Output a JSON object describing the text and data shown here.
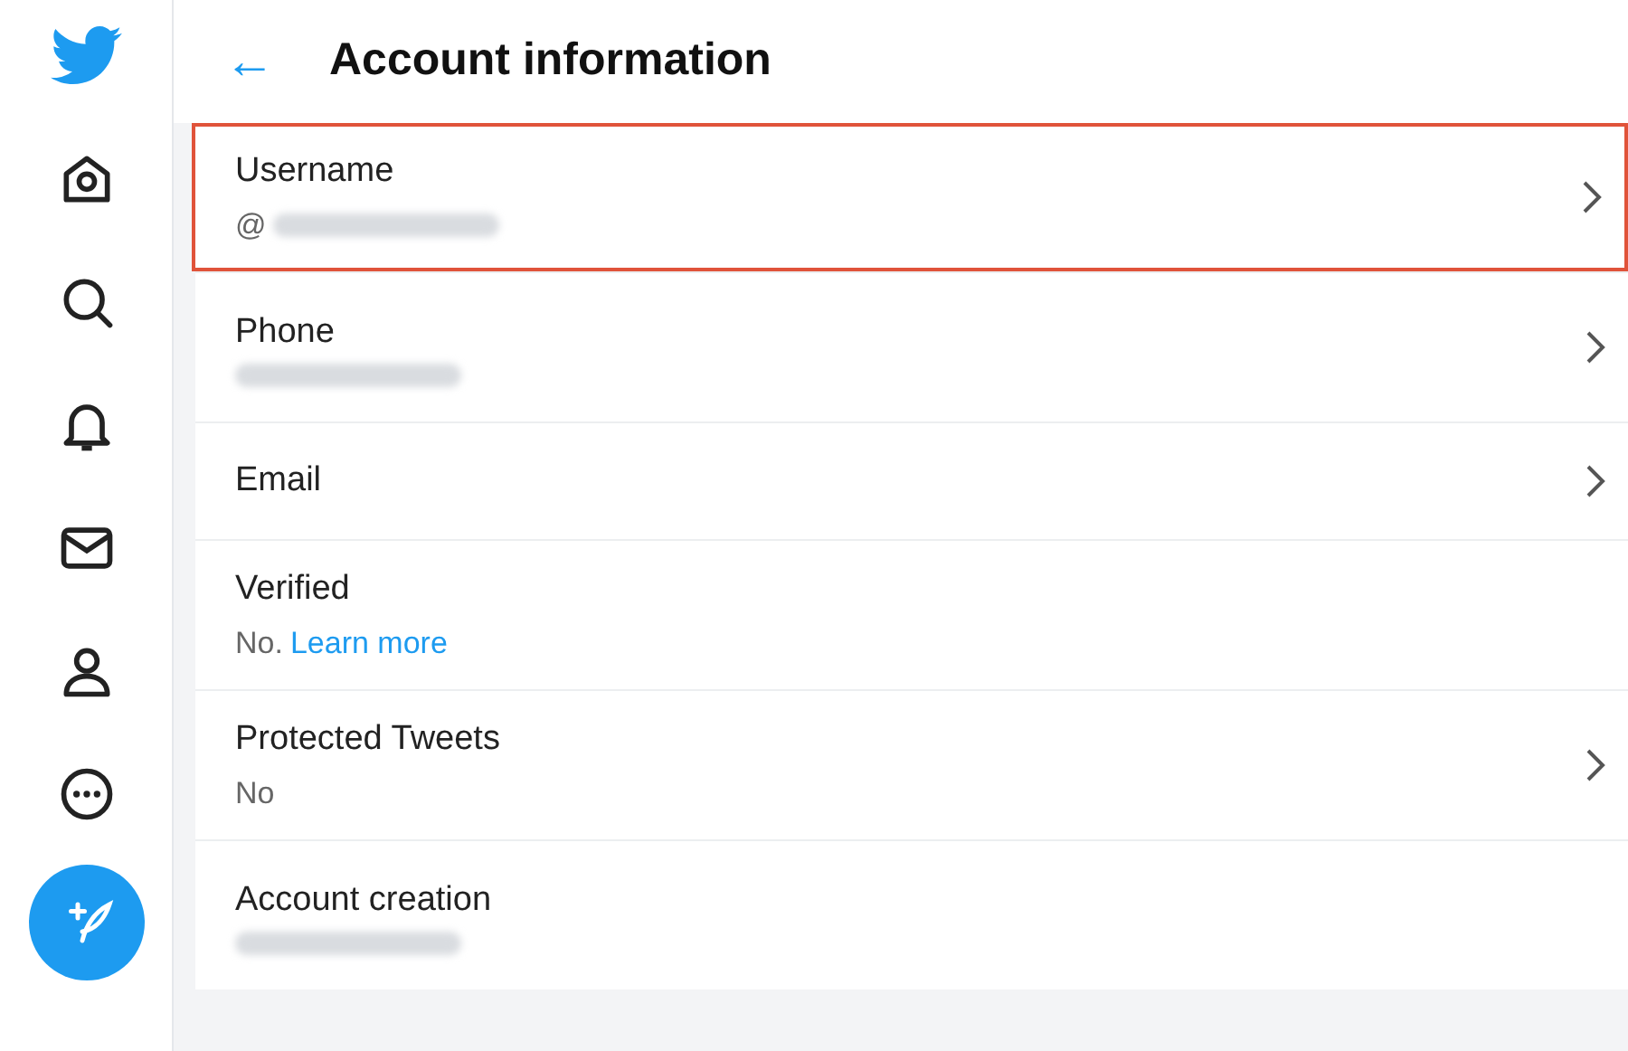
{
  "header": {
    "back": "←",
    "title": "Account information"
  },
  "sidebar": {
    "items": [
      {
        "kind": "home"
      },
      {
        "kind": "search"
      },
      {
        "kind": "bell"
      },
      {
        "kind": "mail"
      },
      {
        "kind": "person"
      },
      {
        "kind": "more"
      }
    ]
  },
  "rows": [
    {
      "title": "Username",
      "subtitle": "@",
      "blurred": true,
      "chevron": true,
      "highlighted": true
    },
    {
      "title": "Phone",
      "blurred": true,
      "chevron": true,
      "highlighted": false
    },
    {
      "title": "Email",
      "chevron": true,
      "highlighted": false
    },
    {
      "title": "Verified",
      "subtitle": "No.",
      "link": "Learn more",
      "chevron": false,
      "highlighted": false
    },
    {
      "title": "Protected Tweets",
      "subtitle": "No",
      "chevron": true,
      "highlighted": false
    },
    {
      "title": "Account creation",
      "blurred": true,
      "chevron": false,
      "highlighted": false
    }
  ]
}
